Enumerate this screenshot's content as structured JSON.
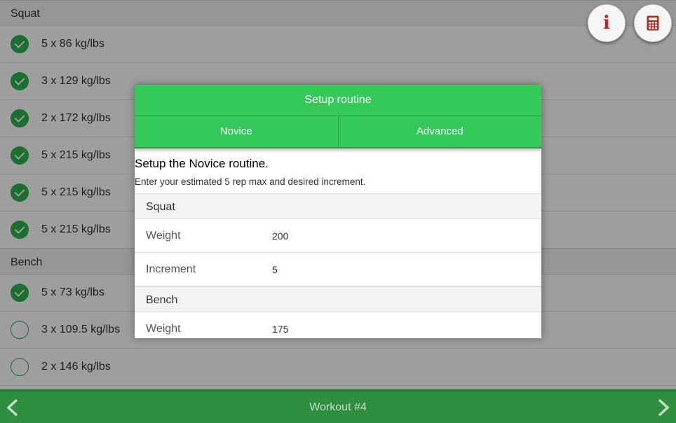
{
  "workout": {
    "sections": [
      {
        "name": "Squat",
        "sets": [
          {
            "label": "5 x 86 kg/lbs",
            "done": true
          },
          {
            "label": "3 x 129 kg/lbs",
            "done": true
          },
          {
            "label": "2 x 172 kg/lbs",
            "done": true
          },
          {
            "label": "5 x 215 kg/lbs",
            "done": true
          },
          {
            "label": "5 x 215 kg/lbs",
            "done": true
          },
          {
            "label": "5 x 215 kg/lbs",
            "done": true
          }
        ]
      },
      {
        "name": "Bench",
        "sets": [
          {
            "label": "5 x 73 kg/lbs",
            "done": true
          },
          {
            "label": "3 x 109.5 kg/lbs",
            "done": false
          },
          {
            "label": "2 x 146 kg/lbs",
            "done": false
          }
        ]
      }
    ]
  },
  "toolbar": {
    "info_icon": "info-icon",
    "calc_icon": "calculator-icon",
    "info_glyph": "i"
  },
  "footer": {
    "title": "Workout #4",
    "prev_icon": "chevron-left-icon",
    "next_icon": "chevron-right-icon"
  },
  "dialog": {
    "title": "Setup routine",
    "tabs": [
      "Novice",
      "Advanced"
    ],
    "heading": "Setup the Novice routine.",
    "description": "Enter your estimated 5 rep max and desired increment.",
    "groups": [
      {
        "name": "Squat",
        "fields": [
          {
            "label": "Weight",
            "value": "200"
          },
          {
            "label": "Increment",
            "value": "5"
          }
        ]
      },
      {
        "name": "Bench",
        "fields": [
          {
            "label": "Weight",
            "value": "175"
          }
        ]
      }
    ]
  },
  "colors": {
    "accent_green": "#35c95c",
    "footer_green": "#2d8f3f",
    "check_green": "#2fb350",
    "info_red": "#b3281f"
  }
}
